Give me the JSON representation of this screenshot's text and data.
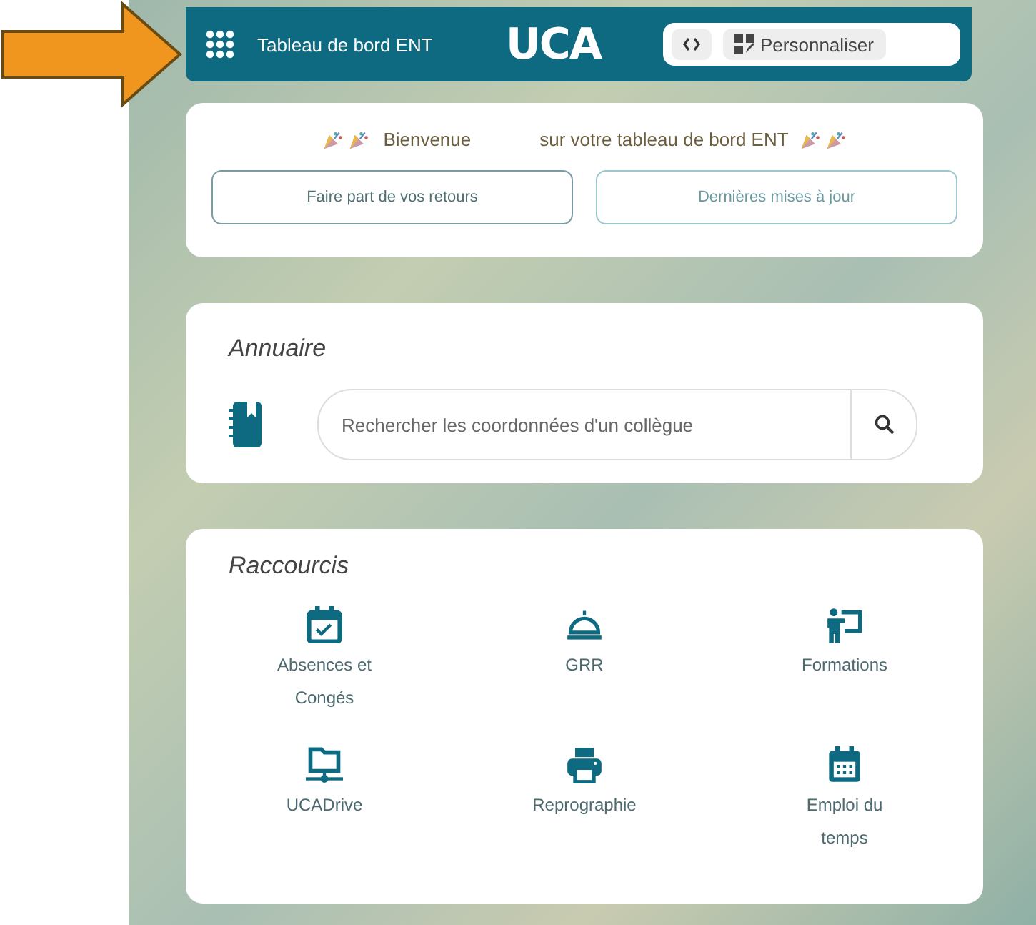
{
  "header": {
    "title": "Tableau de bord ENT",
    "logo": "UCA",
    "customize_button": "Personnaliser"
  },
  "welcome": {
    "greeting": "Bienvenue",
    "message": "sur votre tableau de bord ENT",
    "buttons": [
      "Faire part de vos retours",
      "Dernières mises à jour"
    ]
  },
  "directory": {
    "title": "Annuaire",
    "search": {
      "placeholder": "Rechercher les coordonnées d'un collègue"
    }
  },
  "shortcuts": {
    "title": "Raccourcis",
    "items": [
      {
        "label": "Absences et Congés"
      },
      {
        "label": "GRR"
      },
      {
        "label": "Formations"
      },
      {
        "label": "UCADrive"
      },
      {
        "label": "Reprographie"
      },
      {
        "label": "Emploi du temps"
      }
    ]
  }
}
